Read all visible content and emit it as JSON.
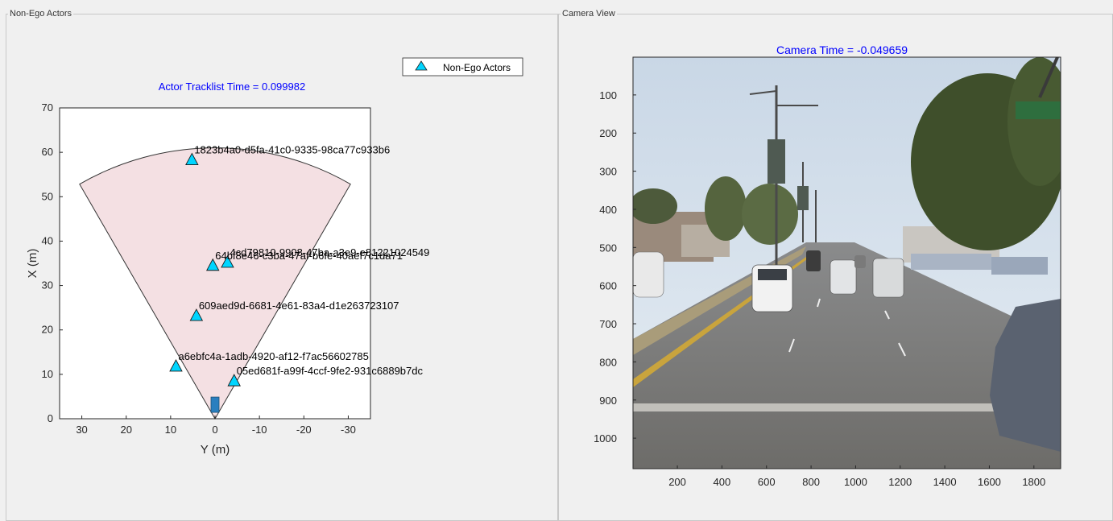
{
  "left_panel": {
    "title": "Non-Ego Actors",
    "plot_title": "Actor Tracklist Time = 0.099982",
    "legend_label": "Non-Ego Actors",
    "xlabel": "Y (m)",
    "ylabel": "X (m)"
  },
  "right_panel": {
    "title": "Camera View",
    "plot_title": "Camera Time = -0.049659"
  },
  "colors": {
    "title_blue": "#0000ff",
    "actor_fill": "#00d5ff",
    "coverage_fill": "#f4e0e3",
    "ego_fill": "#2a7fbf"
  },
  "chart_data": [
    {
      "type": "scatter",
      "title": "Actor Tracklist Time = 0.099982",
      "xlabel": "Y (m)",
      "ylabel": "X (m)",
      "xlim": [
        35,
        -35
      ],
      "ylim": [
        0,
        70
      ],
      "x_reversed": true,
      "xticks": [
        30,
        20,
        10,
        0,
        -10,
        -20,
        -30
      ],
      "yticks": [
        0,
        10,
        20,
        30,
        40,
        50,
        60,
        70
      ],
      "legend": {
        "placement": "top-right",
        "entries": [
          "Non-Ego Actors"
        ]
      },
      "coverage_sector": {
        "range": 61,
        "half_angle_deg": 30
      },
      "ego": {
        "x": 0,
        "y": 1.8
      },
      "series": [
        {
          "name": "Non-Ego Actors",
          "points": [
            {
              "label": "1823b4a0-d5fa-41c0-9335-98ca77c933b6",
              "x": 5.2,
              "y": 58.3
            },
            {
              "label": "4cd79810-9908-47ba-a3e9-e81221024549",
              "x": -2.8,
              "y": 35.2
            },
            {
              "label": "64bf8e46-c3ba-47af-b6fe-40aef7c1da71",
              "x": 0.5,
              "y": 34.5
            },
            {
              "label": "609aed9d-6681-4e61-83a4-d1e263723107",
              "x": 4.2,
              "y": 23.2
            },
            {
              "label": "a6ebfc4a-1adb-4920-af12-f7ac56602785",
              "x": 8.8,
              "y": 11.8
            },
            {
              "label": "05ed681f-a99f-4ccf-9fe2-931c6889b7dc",
              "x": -4.3,
              "y": 8.5
            }
          ]
        }
      ]
    },
    {
      "type": "image",
      "title": "Camera Time = -0.049659",
      "xticks": [
        200,
        400,
        600,
        800,
        1000,
        1200,
        1400,
        1600,
        1800
      ],
      "yticks": [
        100,
        200,
        300,
        400,
        500,
        600,
        700,
        800,
        900,
        1000
      ],
      "xlim": [
        1,
        1920
      ],
      "ylim": [
        1,
        1080
      ],
      "y_reversed": true
    }
  ]
}
